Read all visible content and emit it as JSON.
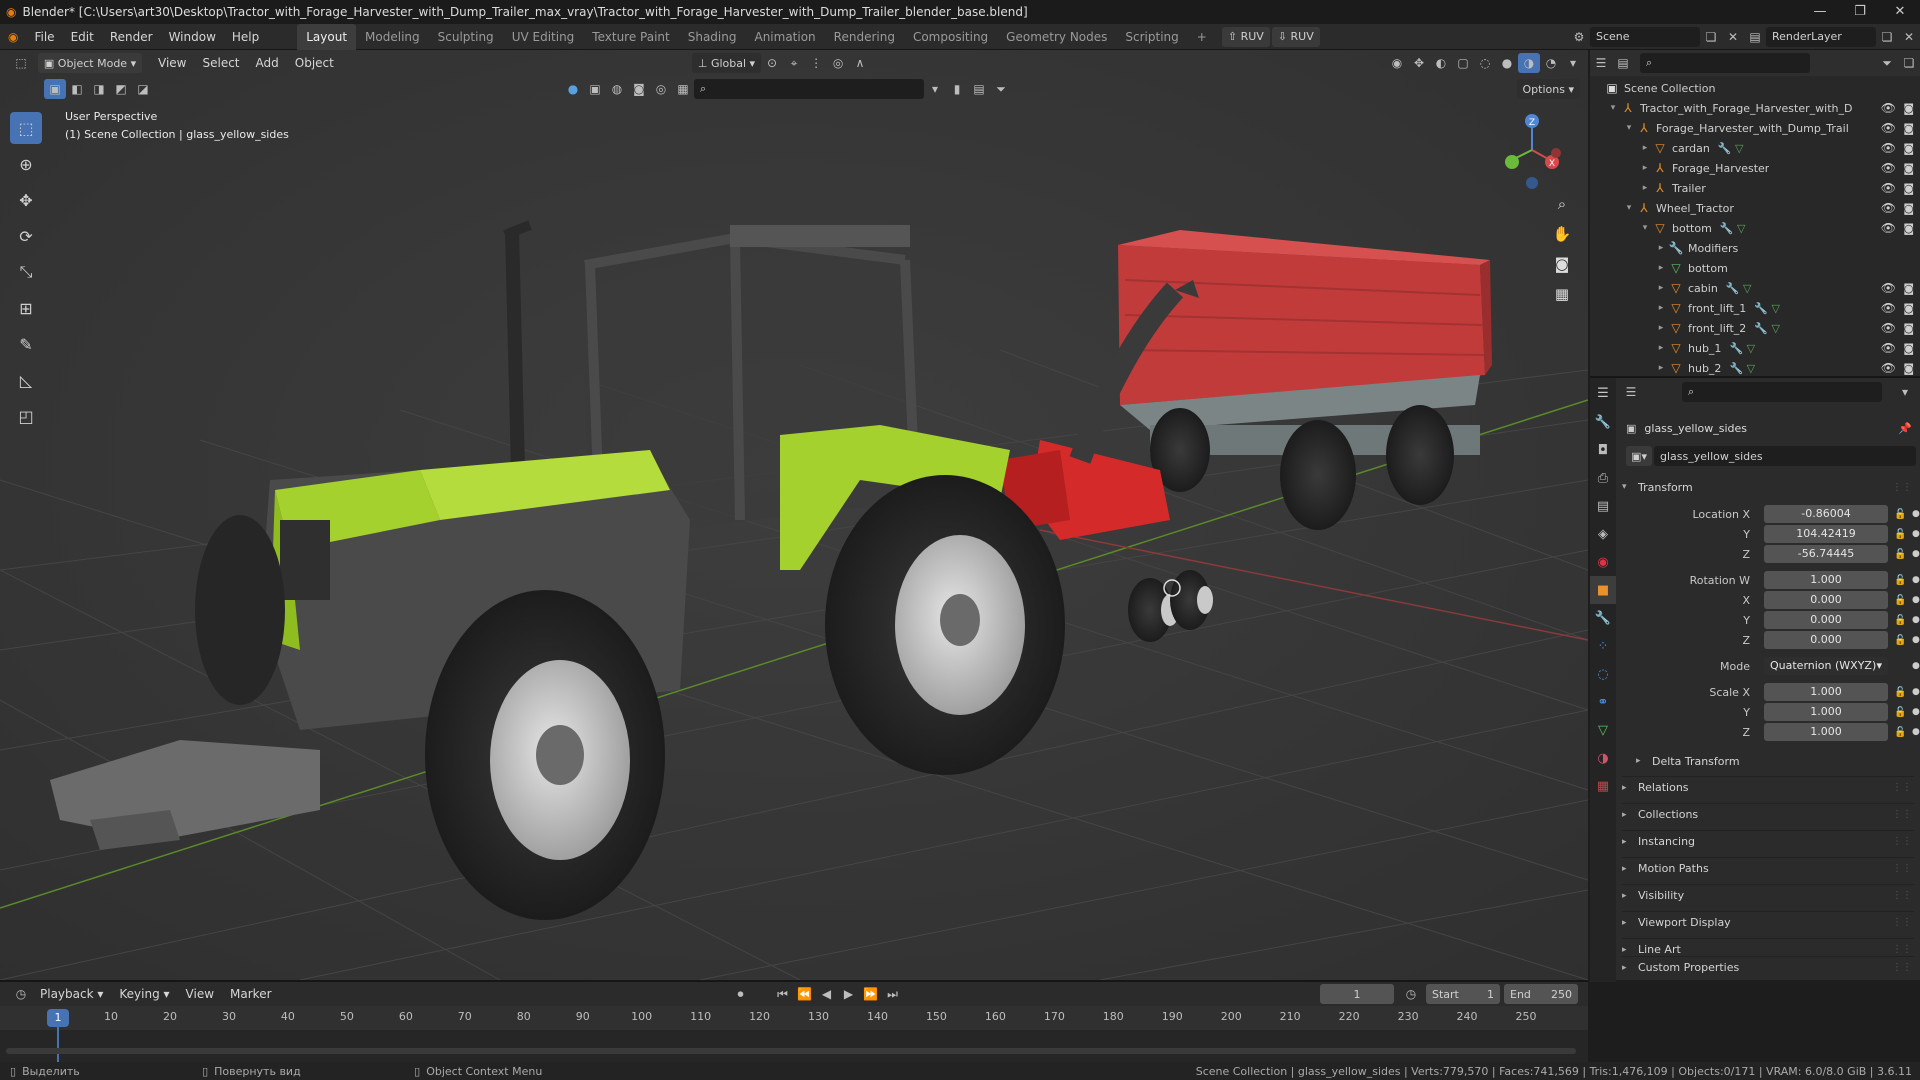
{
  "titlebar": {
    "title": "Blender* [C:\\Users\\art30\\Desktop\\Tractor_with_Forage_Harvester_with_Dump_Trailer_max_vray\\Tractor_with_Forage_Harvester_with_Dump_Trailer_blender_base.blend]"
  },
  "menu": {
    "items": [
      "File",
      "Edit",
      "Render",
      "Window",
      "Help"
    ]
  },
  "workspaces": {
    "tabs": [
      "Layout",
      "Modeling",
      "Sculpting",
      "UV Editing",
      "Texture Paint",
      "Shading",
      "Animation",
      "Rendering",
      "Compositing",
      "Geometry Nodes",
      "Scripting"
    ],
    "active": "Layout"
  },
  "addons": {
    "btn1": "RUV",
    "btn2": "RUV"
  },
  "scene": {
    "name": "Scene",
    "layer": "RenderLayer"
  },
  "viewport": {
    "mode": "Object Mode",
    "menus": [
      "View",
      "Select",
      "Add",
      "Object"
    ],
    "orientation": "Global",
    "options_label": "Options",
    "overlay_line1": "User Perspective",
    "overlay_line2": "(1) Scene Collection | glass_yellow_sides"
  },
  "outliner": {
    "root": "Scene Collection",
    "rows": [
      {
        "label": "Tractor_with_Forage_Harvester_with_D",
        "indent": 1,
        "type": "empty",
        "arrow": "▾",
        "eye": true
      },
      {
        "label": "Forage_Harvester_with_Dump_Trail",
        "indent": 2,
        "type": "empty",
        "arrow": "▾",
        "eye": true
      },
      {
        "label": "cardan",
        "indent": 3,
        "type": "mesh",
        "arrow": "▸",
        "eye": true
      },
      {
        "label": "Forage_Harvester",
        "indent": 3,
        "type": "empty",
        "arrow": "▸",
        "eye": true
      },
      {
        "label": "Trailer",
        "indent": 3,
        "type": "empty",
        "arrow": "▸",
        "eye": true
      },
      {
        "label": "Wheel_Tractor",
        "indent": 2,
        "type": "empty",
        "arrow": "▾",
        "eye": true
      },
      {
        "label": "bottom",
        "indent": 3,
        "type": "mesh",
        "arrow": "▾",
        "eye": true
      },
      {
        "label": "Modifiers",
        "indent": 4,
        "type": "wrench",
        "arrow": "▸",
        "eye": false
      },
      {
        "label": "bottom",
        "indent": 4,
        "type": "meshdata",
        "arrow": "▸",
        "eye": false
      },
      {
        "label": "cabin",
        "indent": 4,
        "type": "mesh",
        "arrow": "▸",
        "eye": true
      },
      {
        "label": "front_lift_1",
        "indent": 4,
        "type": "mesh",
        "arrow": "▸",
        "eye": true
      },
      {
        "label": "front_lift_2",
        "indent": 4,
        "type": "mesh",
        "arrow": "▸",
        "eye": true
      },
      {
        "label": "hub_1",
        "indent": 4,
        "type": "mesh",
        "arrow": "▸",
        "eye": true
      },
      {
        "label": "hub_2",
        "indent": 4,
        "type": "mesh",
        "arrow": "▸",
        "eye": true
      }
    ]
  },
  "properties": {
    "object_name": "glass_yellow_sides",
    "data_name": "glass_yellow_sides",
    "transform_label": "Transform",
    "location_x_label": "Location X",
    "location_x": "-0.86004",
    "location_y_label": "Y",
    "location_y": "104.42419",
    "location_z_label": "Z",
    "location_z": "-56.74445",
    "rotation_w_label": "Rotation W",
    "rotation_w": "1.000",
    "rotation_x_label": "X",
    "rotation_x": "0.000",
    "rotation_y_label": "Y",
    "rotation_y": "0.000",
    "rotation_z_label": "Z",
    "rotation_z": "0.000",
    "mode_label": "Mode",
    "mode_value": "Quaternion (WXYZ)",
    "scale_x_label": "Scale X",
    "scale_x": "1.000",
    "scale_y_label": "Y",
    "scale_y": "1.000",
    "scale_z_label": "Z",
    "scale_z": "1.000",
    "delta_transform": "Delta Transform",
    "sections": [
      "Relations",
      "Collections",
      "Instancing",
      "Motion Paths",
      "Visibility",
      "Viewport Display",
      "Line Art",
      "Custom Properties"
    ]
  },
  "timeline": {
    "menus": [
      "Playback",
      "Keying",
      "View",
      "Marker"
    ],
    "current_frame": "1",
    "start_label": "Start",
    "start": "1",
    "end_label": "End",
    "end": "250",
    "ticks": [
      "10",
      "20",
      "30",
      "40",
      "50",
      "60",
      "70",
      "80",
      "90",
      "100",
      "110",
      "120",
      "130",
      "140",
      "150",
      "160",
      "170",
      "180",
      "190",
      "200",
      "210",
      "220",
      "230",
      "240",
      "250"
    ],
    "playhead_label": "1"
  },
  "statusbar": {
    "left1": "Выделить",
    "left2": "Повернуть вид",
    "left3": "Object Context Menu",
    "right": "Scene Collection | glass_yellow_sides | Verts:779,570 | Faces:741,569 | Tris:1,476,109 | Objects:0/171 | VRAM: 6.0/8.0 GiB | 3.6.11"
  },
  "colors": {
    "accent": "#4772b3",
    "tractor_green": "#a4d12e",
    "trailer_red": "#c23b3b",
    "harvester_red": "#d42a2a",
    "blender_orange": "#e87d0d"
  }
}
